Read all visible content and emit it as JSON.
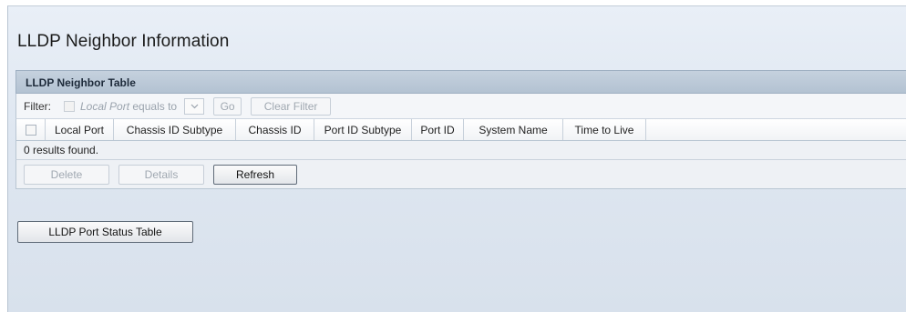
{
  "page": {
    "title": "LLDP Neighbor Information",
    "background_color": "#dfe7f1",
    "accent_color": "#b3c2d2"
  },
  "neighbor_table": {
    "title": "LLDP Neighbor Table",
    "filter": {
      "label": "Filter:",
      "field_label": "Local Port",
      "operator_text": "equals to",
      "select_icon": "chevron-down-icon",
      "go_label": "Go",
      "clear_label": "Clear Filter"
    },
    "columns": [
      "Local Port",
      "Chassis ID Subtype",
      "Chassis ID",
      "Port ID Subtype",
      "Port ID",
      "System Name",
      "Time to Live"
    ],
    "rows": [],
    "results_text": "0 results found.",
    "actions": {
      "delete_label": "Delete",
      "details_label": "Details",
      "refresh_label": "Refresh"
    }
  },
  "port_status_button_label": "LLDP Port Status Table"
}
